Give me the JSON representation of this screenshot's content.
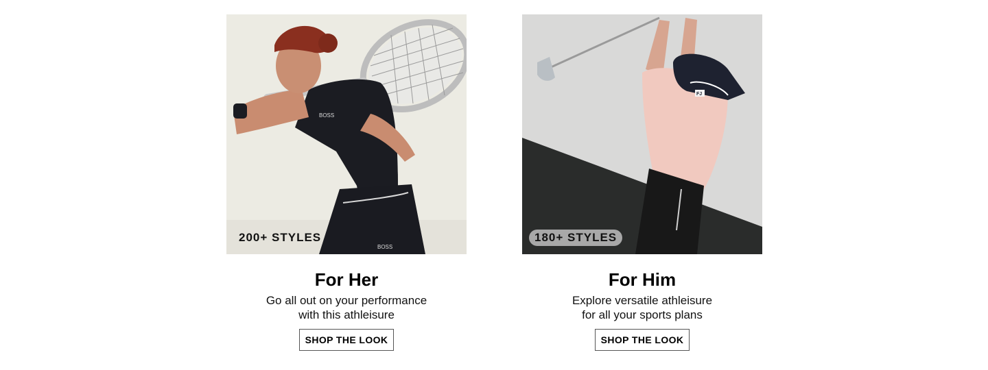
{
  "cards": [
    {
      "badge": "200+ STYLES",
      "title": "For Her",
      "description_lines": [
        "Go all out on your performance",
        "with this athleisure"
      ],
      "cta": "SHOP THE LOOK",
      "photo_logo_chest": "BOSS",
      "photo_logo_shorts": "BOSS"
    },
    {
      "badge": "180+ STYLES",
      "title": "For Him",
      "description_lines": [
        "Explore versatile athleisure",
        "for all your sports plans"
      ],
      "cta": "SHOP THE LOOK",
      "photo_logo_cap": "FJ"
    }
  ]
}
